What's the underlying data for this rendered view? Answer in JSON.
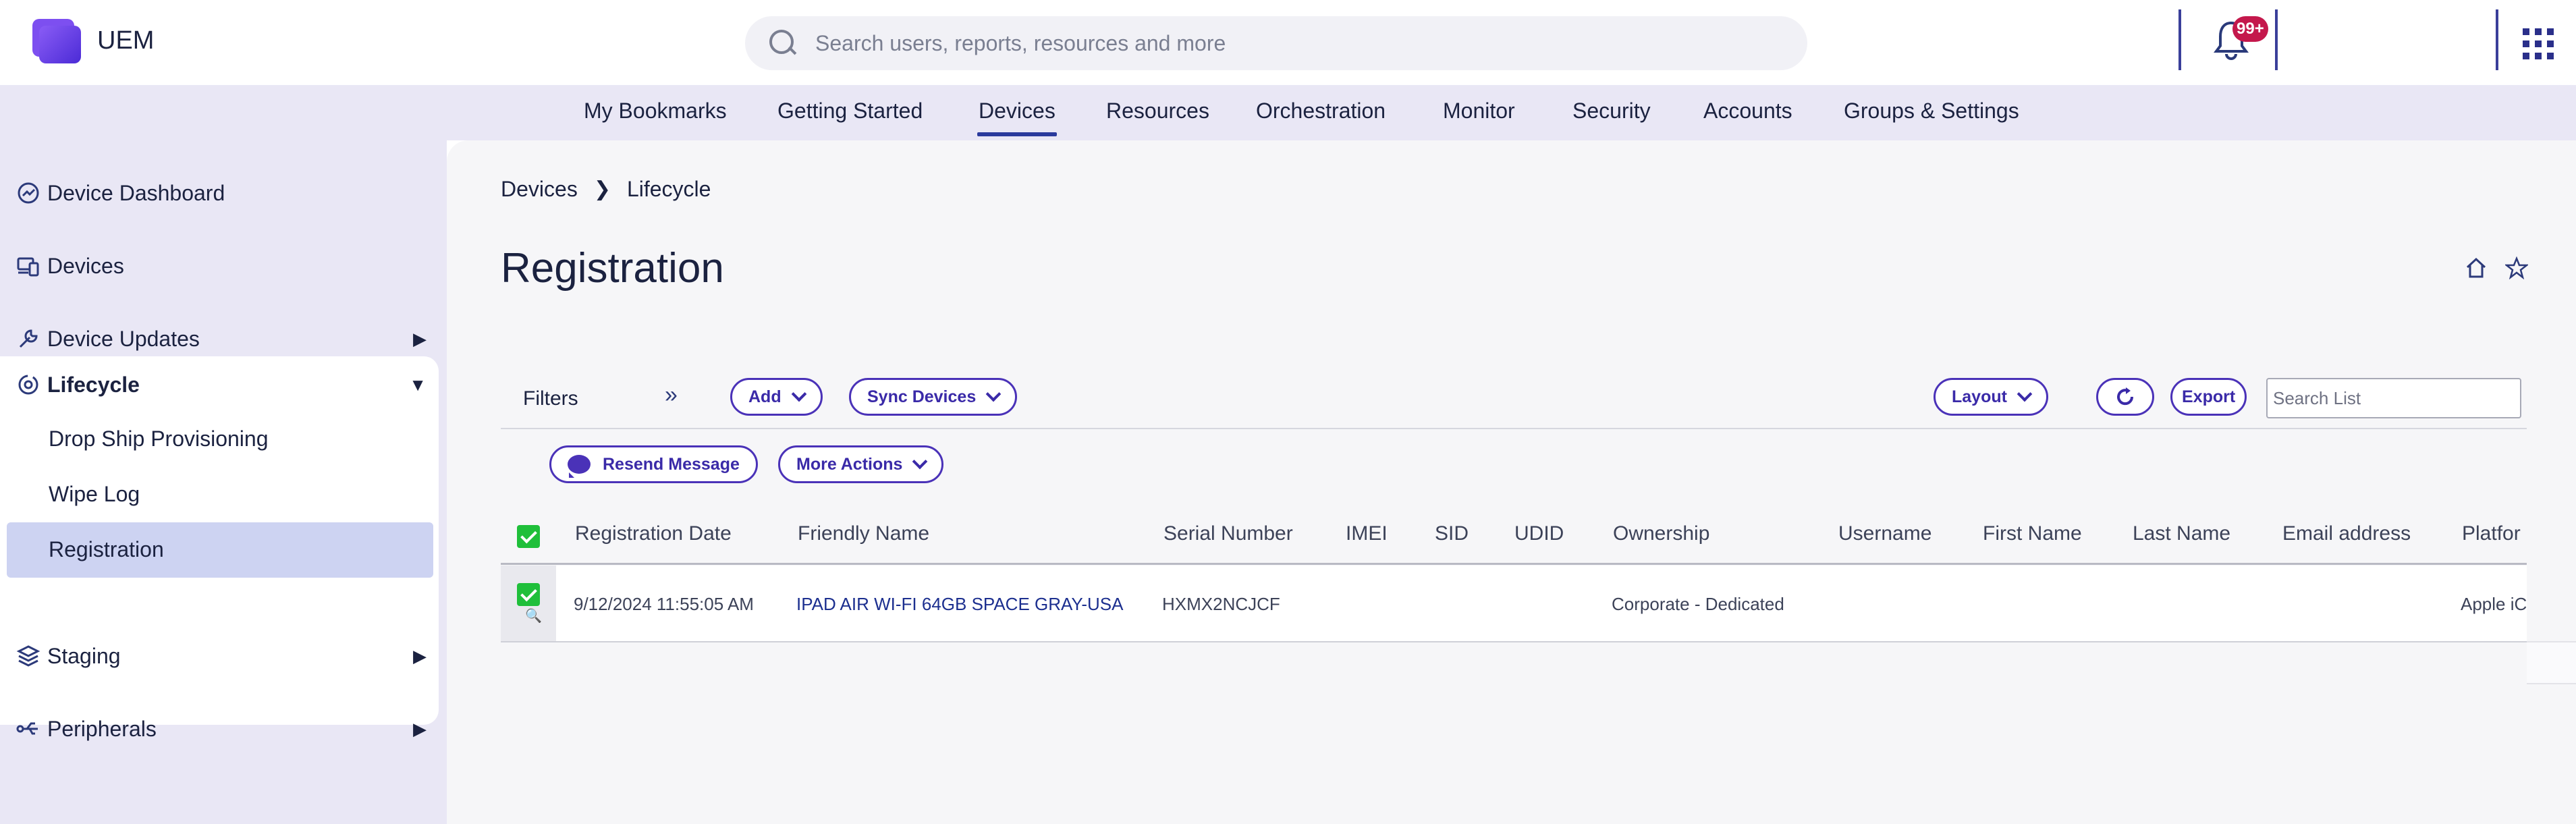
{
  "app": {
    "name": "UEM"
  },
  "header": {
    "search_placeholder": "Search users, reports, resources and more",
    "notifications_badge": "99+"
  },
  "topnav": {
    "items": [
      "My Bookmarks",
      "Getting Started",
      "Devices",
      "Resources",
      "Orchestration",
      "Monitor",
      "Security",
      "Accounts",
      "Groups & Settings"
    ],
    "active": "Devices"
  },
  "sidebar": {
    "items": [
      {
        "label": "Device Dashboard",
        "icon": "dashboard-icon"
      },
      {
        "label": "Devices",
        "icon": "devices-icon"
      },
      {
        "label": "Device Updates",
        "icon": "wrench-icon"
      },
      {
        "label": "Lifecycle",
        "icon": "lifecycle-icon"
      },
      {
        "label": "Staging",
        "icon": "layers-icon"
      },
      {
        "label": "Peripherals",
        "icon": "usb-icon"
      }
    ],
    "lifecycle_sub": [
      "Drop Ship Provisioning",
      "Wipe Log",
      "Registration"
    ],
    "active_sub": "Registration"
  },
  "breadcrumb": {
    "root": "Devices",
    "current": "Lifecycle"
  },
  "page": {
    "title": "Registration"
  },
  "toolbar": {
    "filters": "Filters",
    "add": "Add",
    "sync_devices": "Sync Devices",
    "layout": "Layout",
    "export": "Export",
    "search_placeholder": "Search List",
    "resend_message": "Resend Message",
    "more_actions": "More Actions"
  },
  "grid": {
    "columns": [
      "Registration Date",
      "Friendly Name",
      "Serial Number",
      "IMEI",
      "SID",
      "UDID",
      "Ownership",
      "Username",
      "First Name",
      "Last Name",
      "Email address",
      "Platfor"
    ],
    "rows": [
      {
        "registration_date": "9/12/2024 11:55:05 AM",
        "friendly_name": "IPAD AIR WI-FI 64GB SPACE GRAY-USA",
        "serial_number": "HXMX2NCJCF",
        "imei": "",
        "sid": "",
        "udid": "",
        "ownership": "Corporate - Dedicated",
        "username": "",
        "first_name": "",
        "last_name": "",
        "email": "",
        "platform": "Apple iC"
      }
    ]
  },
  "colors": {
    "accent": "#4a32b8",
    "nav_bg": "#e9e7f5",
    "active_underline": "#2a3a9c",
    "check": "#1fbf3a",
    "badge": "#c4184c"
  }
}
